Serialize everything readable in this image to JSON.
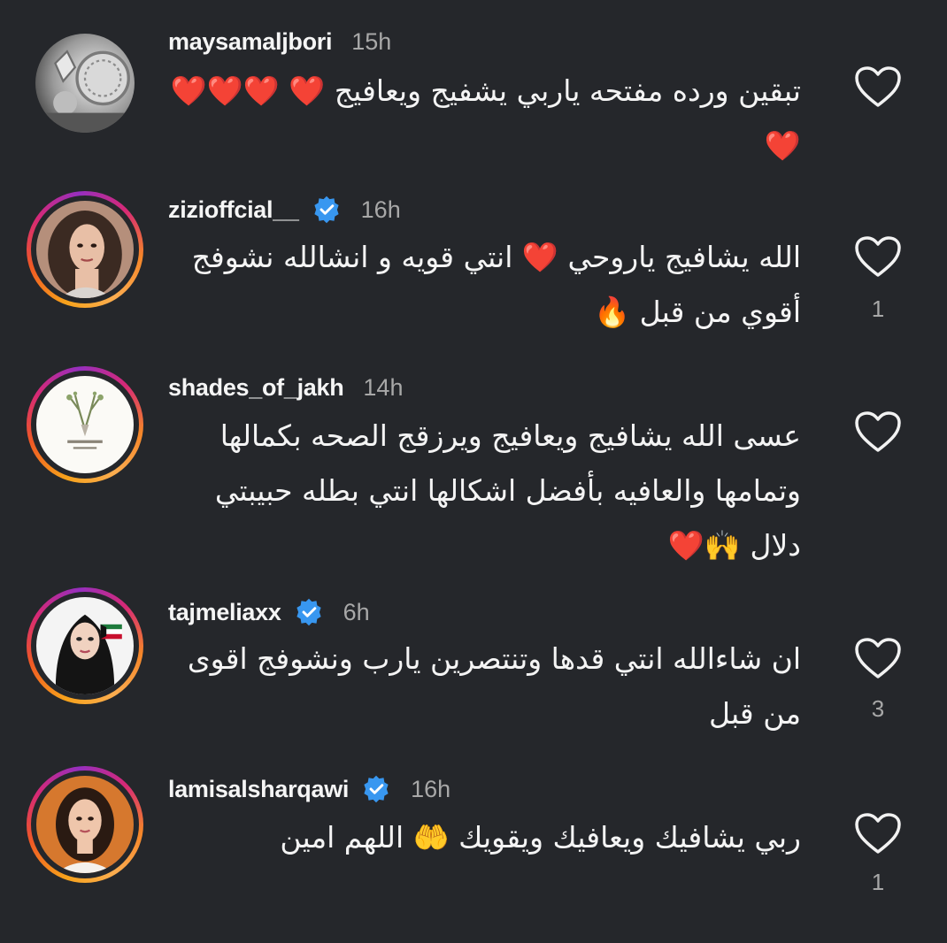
{
  "comments": [
    {
      "username": "maysamaljbori",
      "verified": false,
      "time": "15h",
      "text": "تبقين ورده مفتحه ياربي يشفيج ويعافيج ❤️ ❤️❤️❤️❤️",
      "likes": "",
      "avatar_icon": "silver-ornaments-photo"
    },
    {
      "username": "zizioffcial__",
      "verified": true,
      "time": "16h",
      "text": "الله يشافيج ياروحي ❤️ انتي قويه و انشالله نشوفج أقوي من قبل 🔥",
      "likes": "1",
      "avatar_icon": "woman-portrait-photo"
    },
    {
      "username": "shades_of_jakh",
      "verified": false,
      "time": "14h",
      "text": "عسى الله يشافيج ويعافيج ويرزقج الصحه بكمالها وتمامها والعافيه بأفضل اشكالها انتي بطله حبيبتي دلال 🙌❤️",
      "likes": "",
      "avatar_icon": "deer-logo"
    },
    {
      "username": "tajmeliaxx",
      "verified": true,
      "time": "6h",
      "text": "ان شاءالله انتي قدها وتنتصرين يارب ونشوفج اقوى من قبل",
      "likes": "3",
      "avatar_icon": "illustrated-woman-flag"
    },
    {
      "username": "lamisalsharqawi",
      "verified": true,
      "time": "16h",
      "text": "ربي يشافيك ويعافيك ويقويك 🤲 اللهم امين",
      "likes": "1",
      "avatar_icon": "woman-portrait-photo"
    }
  ],
  "colors": {
    "background": "#25272b",
    "verified_badge": "#3897f0",
    "muted_text": "#a8a8a8"
  }
}
